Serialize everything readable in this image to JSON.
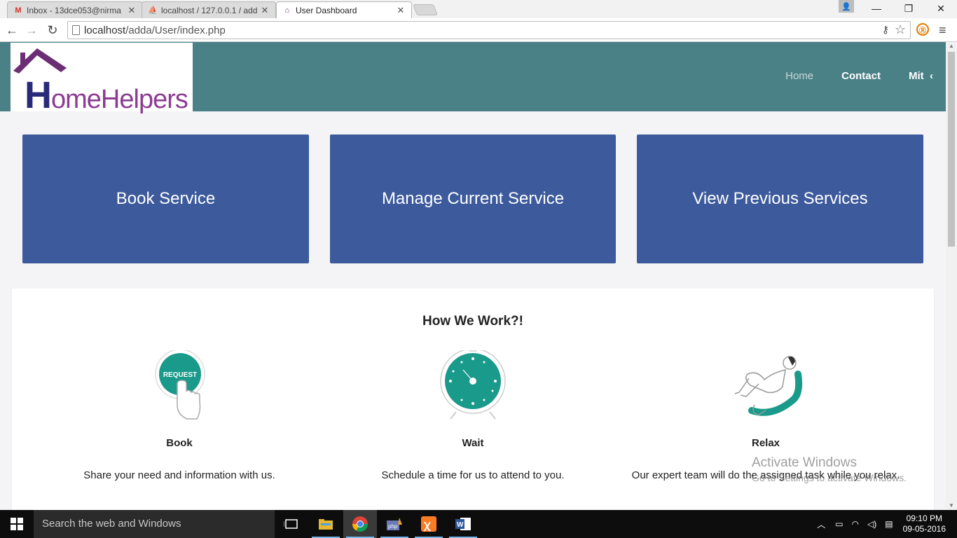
{
  "browser": {
    "tabs": [
      {
        "title": "Inbox - 13dce053@nirma",
        "favicon": "gmail-icon",
        "active": false
      },
      {
        "title": "localhost / 127.0.0.1 / add",
        "favicon": "phpmyadmin-icon",
        "active": false
      },
      {
        "title": "User Dashboard",
        "favicon": "homehelpers-icon",
        "active": true
      }
    ],
    "url_host": "localhost",
    "url_path": "/adda/User/index.php"
  },
  "site": {
    "logo_text_big": "H",
    "logo_text_rest": "omeHelpers",
    "nav": [
      "Home",
      "Contact",
      "Mit"
    ],
    "cards": [
      "Book Service",
      "Manage Current Service",
      "View Previous Services"
    ],
    "how_title": "How We Work?!",
    "steps": [
      {
        "name": "Book",
        "desc": "Share your need and information with us.",
        "icon": "request-button-icon",
        "badge": "REQUEST"
      },
      {
        "name": "Wait",
        "desc": "Schedule a time for us to attend to you.",
        "icon": "clock-icon"
      },
      {
        "name": "Relax",
        "desc": "Our expert team will do the assigned task while you relax.",
        "icon": "relaxing-person-icon"
      }
    ],
    "accent_color": "#4a8187",
    "card_color": "#3c5a9c",
    "icon_color": "#1a9a8a"
  },
  "watermark": {
    "line1": "Activate Windows",
    "line2": "Go to Settings to activate Windows."
  },
  "taskbar": {
    "search_placeholder": "Search the web and Windows",
    "time": "09:10 PM",
    "date": "09-05-2016"
  }
}
